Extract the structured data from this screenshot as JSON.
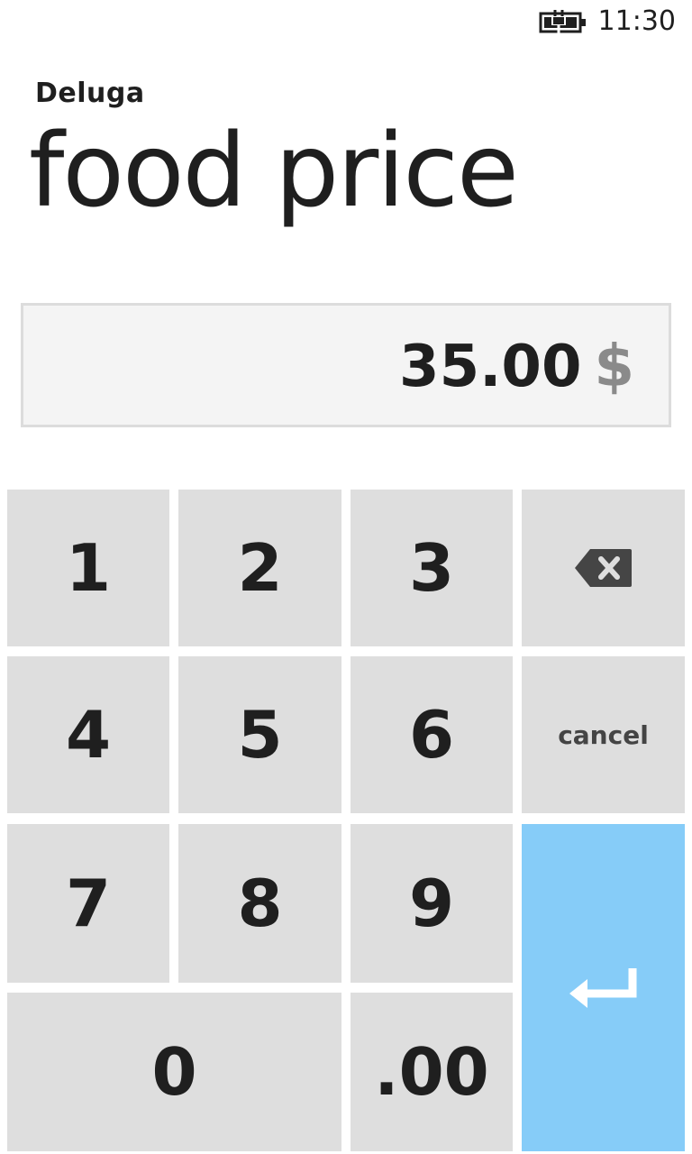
{
  "status_bar": {
    "battery_icon": "battery-charging-icon",
    "time": "11:30"
  },
  "header": {
    "app_name": "Deluga",
    "page_title": "food price"
  },
  "amount": {
    "value": "35.00",
    "currency": "$"
  },
  "keypad": {
    "keys": {
      "k1": "1",
      "k2": "2",
      "k3": "3",
      "k4": "4",
      "k5": "5",
      "k6": "6",
      "k7": "7",
      "k8": "8",
      "k9": "9",
      "k0": "0",
      "decimal": ".00",
      "cancel": "cancel"
    },
    "backspace_icon": "backspace-icon",
    "enter_icon": "enter-icon"
  },
  "colors": {
    "key_background": "#dedede",
    "enter_key_background": "#86ccf8",
    "field_background": "#f4f4f4",
    "field_border": "#dcdcdc",
    "currency_color": "#8a8a8a"
  }
}
